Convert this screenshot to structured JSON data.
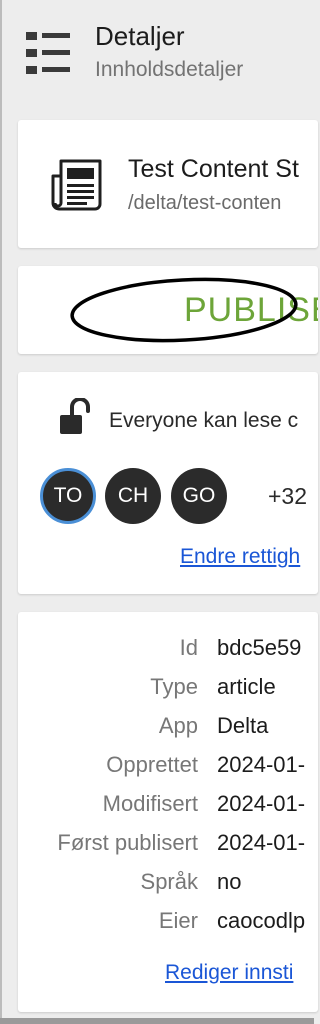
{
  "header": {
    "title": "Detaljer",
    "subtitle": "Innholdsdetaljer",
    "menu_icon": "list-menu-icon"
  },
  "content": {
    "title": "Test Content St",
    "path": "/delta/test-conten",
    "icon": "newspaper-icon"
  },
  "status": {
    "label": "PUBLISE",
    "color": "#6da539"
  },
  "access": {
    "lock_icon": "unlocked-padlock-icon",
    "text": "Everyone kan lese c",
    "avatars": [
      {
        "initials": "TO",
        "selected": true
      },
      {
        "initials": "CH",
        "selected": false
      },
      {
        "initials": "GO",
        "selected": false
      }
    ],
    "more_count": "+32",
    "change_link": "Endre rettigh"
  },
  "metadata": {
    "rows": [
      {
        "label": "Id",
        "value": "bdc5e59"
      },
      {
        "label": "Type",
        "value": "article"
      },
      {
        "label": "App",
        "value": "Delta"
      },
      {
        "label": "Opprettet",
        "value": "2024-01-"
      },
      {
        "label": "Modifisert",
        "value": "2024-01-"
      },
      {
        "label": "Først publisert",
        "value": "2024-01-"
      },
      {
        "label": "Språk",
        "value": "no"
      },
      {
        "label": "Eier",
        "value": "caocodlp"
      }
    ],
    "edit_link": "Rediger innsti"
  },
  "colors": {
    "accent_link": "#1a56d6",
    "avatar_bg": "#2b2b2b",
    "avatar_selected_ring": "#4a8fd6"
  }
}
